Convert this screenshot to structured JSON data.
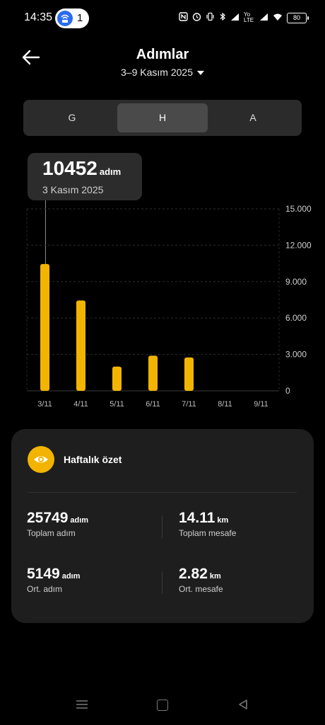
{
  "status_bar": {
    "time": "14:35",
    "hotspot_count": "1",
    "network_label": "Yo LTE",
    "battery": "80"
  },
  "header": {
    "title": "Adımlar",
    "date_range": "3–9 Kasım 2025"
  },
  "tabs": [
    {
      "label": "G",
      "selected": false
    },
    {
      "label": "H",
      "selected": true
    },
    {
      "label": "A",
      "selected": false
    }
  ],
  "tooltip": {
    "value": "10452",
    "unit": "adım",
    "date": "3 Kasım 2025"
  },
  "chart_data": {
    "type": "bar",
    "categories": [
      "3/11",
      "4/11",
      "5/11",
      "6/11",
      "7/11",
      "8/11",
      "9/11"
    ],
    "values": [
      10452,
      7450,
      2000,
      2900,
      2750,
      0,
      0
    ],
    "y_ticks": [
      "15.000",
      "12.000",
      "9.000",
      "6.000",
      "3.000",
      "0"
    ],
    "y_tick_values": [
      15000,
      12000,
      9000,
      6000,
      3000,
      0
    ],
    "ylim": [
      0,
      15000
    ],
    "selected_index": 0,
    "bar_color": "#f2b400",
    "grid": "dashed"
  },
  "summary": {
    "title": "Haftalık özet",
    "total_steps": {
      "value": "25749",
      "unit": "adım",
      "label": "Toplam adım"
    },
    "total_distance": {
      "value": "14.11",
      "unit": "km",
      "label": "Toplam mesafe"
    },
    "avg_steps": {
      "value": "5149",
      "unit": "adım",
      "label": "Ort. adım"
    },
    "avg_distance": {
      "value": "2.82",
      "unit": "km",
      "label": "Ort. mesafe"
    }
  },
  "colors": {
    "accent": "#f2b400",
    "background": "#000000",
    "card": "#1e1e1e"
  }
}
